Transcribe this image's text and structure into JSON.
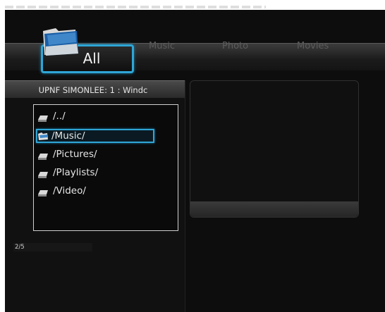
{
  "tabs": {
    "items": [
      {
        "label": "All",
        "selected": true,
        "icon": "folder-icon"
      },
      {
        "label": "Music",
        "selected": false
      },
      {
        "label": "Photo",
        "selected": false
      },
      {
        "label": "Movies",
        "selected": false
      }
    ]
  },
  "browser": {
    "title": "UPNF SIMONLEE: 1 : Windc",
    "items": [
      {
        "label": "/../",
        "icon": "drive-icon",
        "selected": false
      },
      {
        "label": "/Music/",
        "icon": "folder-icon",
        "selected": true
      },
      {
        "label": "/Pictures/",
        "icon": "drive-icon",
        "selected": false
      },
      {
        "label": "/Playlists/",
        "icon": "drive-icon",
        "selected": false
      },
      {
        "label": "/Video/",
        "icon": "drive-icon",
        "selected": false
      }
    ],
    "position": "2/5"
  },
  "colors": {
    "accent": "#2fa6d6",
    "background": "#0d0d0d",
    "text": "#e6e6e6",
    "inactive_tab": "#5c5c5c"
  }
}
